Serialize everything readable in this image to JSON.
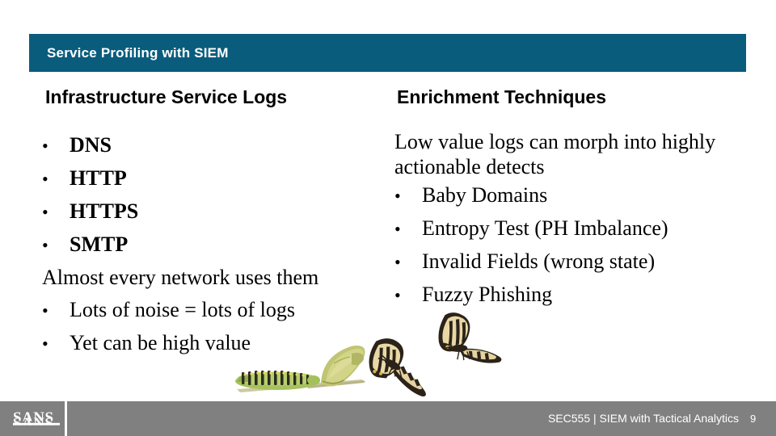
{
  "slide": {
    "title": "Service Profiling with SIEM",
    "title_bar_color": "#0a5c7d",
    "background_color": "#ffffff"
  },
  "left_column": {
    "heading": "Infrastructure Service Logs",
    "bullets_top": [
      {
        "bullet": "•",
        "label": "DNS"
      },
      {
        "bullet": "•",
        "label": "HTTP"
      },
      {
        "bullet": "•",
        "label": "HTTPS"
      },
      {
        "bullet": "•",
        "label": "SMTP"
      }
    ],
    "statement": "Almost every network uses them",
    "bullets_bottom": [
      {
        "bullet": "•",
        "label": "Lots of noise = lots of logs"
      },
      {
        "bullet": "•",
        "label": "Yet can be high value"
      }
    ]
  },
  "right_column": {
    "heading": "Enrichment Techniques",
    "intro": "Low value logs can morph into highly actionable detects",
    "bullets": [
      {
        "bullet": "•",
        "label": "Baby Domains"
      },
      {
        "bullet": "•",
        "label": "Entropy Test (PH Imbalance)"
      },
      {
        "bullet": "•",
        "label": "Invalid Fields (wrong state)"
      },
      {
        "bullet": "•",
        "label": "Fuzzy Phishing"
      }
    ]
  },
  "artwork": {
    "name": "butterfly-metamorphosis-illustration",
    "stages": [
      "caterpillar",
      "chrysalis",
      "butterfly",
      "butterfly"
    ],
    "colors": {
      "caterpillar_body": "#9dbb55",
      "caterpillar_band": "#2b2a20",
      "chrysalis": "#b8bf6d",
      "twig": "#cdc8a0",
      "butterfly_wing": "#e9d9a4",
      "butterfly_pattern": "#2b2319"
    }
  },
  "footer": {
    "logo_text": "SANS",
    "course_text": "SEC555 | SIEM with Tactical Analytics",
    "page_number": "9",
    "bar_color": "#808080",
    "text_color": "#ffffff"
  }
}
